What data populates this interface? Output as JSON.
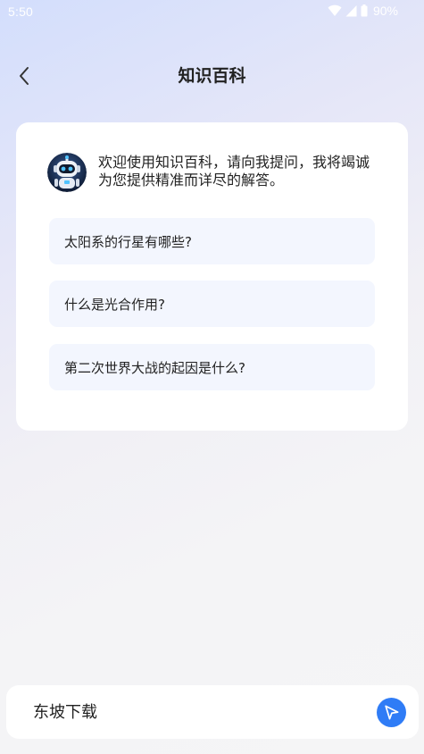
{
  "status_bar": {
    "time": "5:50",
    "battery": "90%"
  },
  "header": {
    "title": "知识百科"
  },
  "welcome": {
    "message": "欢迎使用知识百科，请向我提问，我将竭诚为您提供精准而详尽的解答。"
  },
  "suggestions": [
    {
      "label": "太阳系的行星有哪些?"
    },
    {
      "label": "什么是光合作用?"
    },
    {
      "label": "第二次世界大战的起因是什么?"
    }
  ],
  "input": {
    "placeholder": "东坡下载"
  },
  "colors": {
    "accent": "#2f7cf6",
    "suggestion_bg": "#f3f6fe"
  },
  "icons": {
    "back": "chevron-left-icon",
    "send": "paper-plane-icon",
    "wifi": "wifi-icon",
    "signal": "signal-icon",
    "battery": "battery-icon"
  }
}
